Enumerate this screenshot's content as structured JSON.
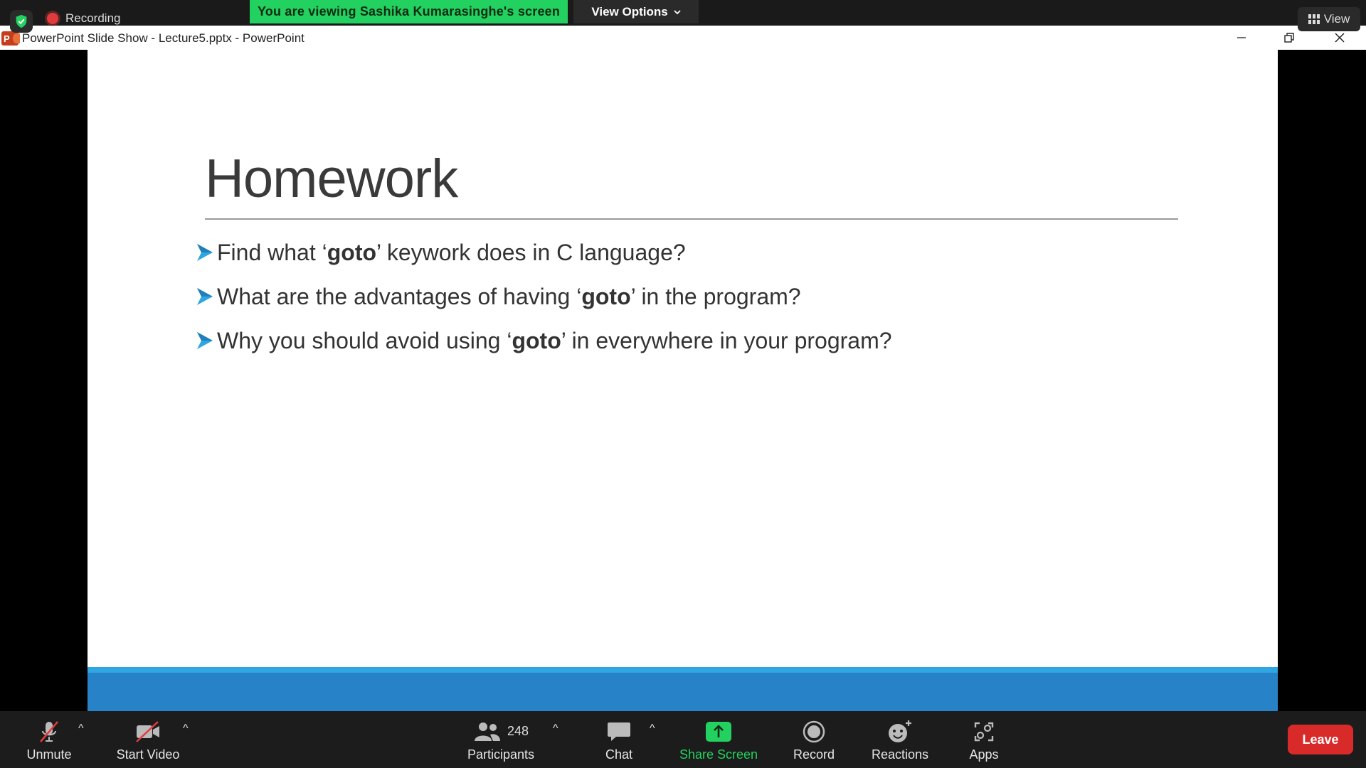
{
  "zoom": {
    "recording_label": "Recording",
    "viewing_banner": "You are viewing Sashika Kumarasinghe's screen",
    "view_options_label": "View Options",
    "view_label": "View"
  },
  "window": {
    "title": "PowerPoint Slide Show  -  Lecture5.pptx - PowerPoint",
    "app_icon_letter": "P"
  },
  "slide": {
    "title": "Homework",
    "bullets": [
      {
        "pre": "Find what ‘",
        "bold": "goto",
        "post": "’ keywork does in C language?"
      },
      {
        "pre": "What are the advantages of having ‘",
        "bold": "goto",
        "post": "’ in the program?"
      },
      {
        "pre": "Why you should avoid using ‘",
        "bold": "goto",
        "post": "’ in everywhere in your program?"
      }
    ],
    "accent_color": "#2fa6e1",
    "footer_color": "#2882c8"
  },
  "toolbar": {
    "unmute_label": "Unmute",
    "start_video_label": "Start Video",
    "participants_label": "Participants",
    "participants_count": "248",
    "chat_label": "Chat",
    "share_screen_label": "Share Screen",
    "record_label": "Record",
    "reactions_label": "Reactions",
    "apps_label": "Apps",
    "leave_label": "Leave"
  },
  "colors": {
    "share_green": "#23d160",
    "leave_red": "#d92a2a"
  }
}
